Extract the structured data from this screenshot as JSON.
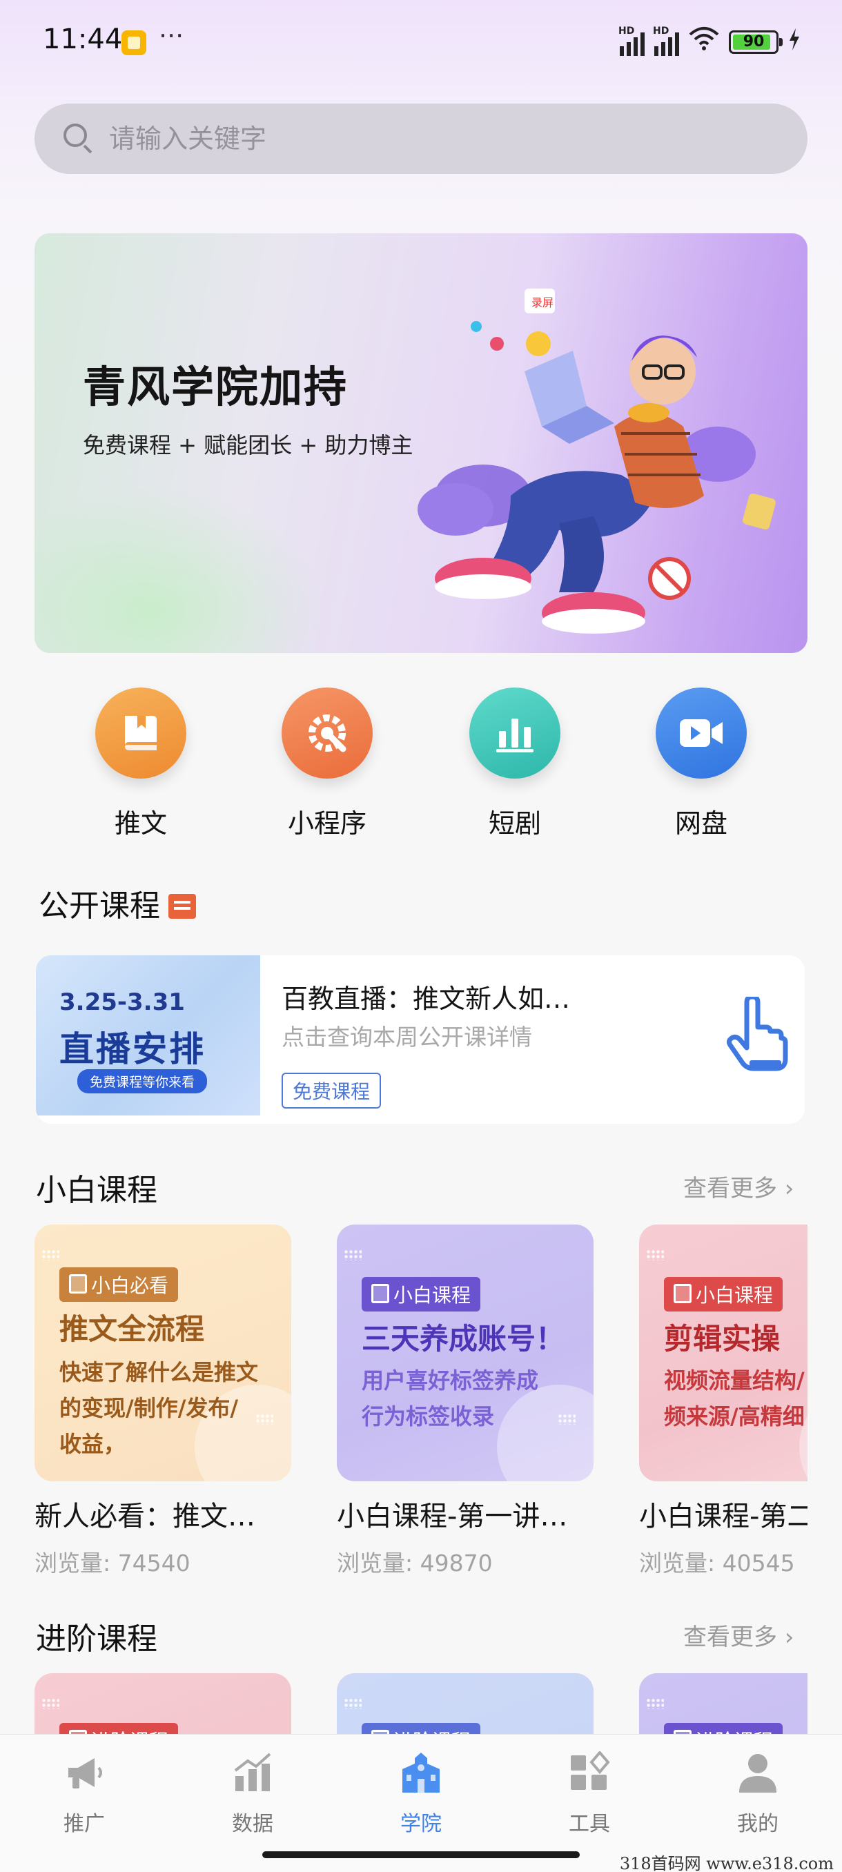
{
  "status_bar": {
    "time": "11:44",
    "battery": "90",
    "more": "···"
  },
  "search": {
    "placeholder": "请输入关键字"
  },
  "banner": {
    "title": "青风学院加持",
    "subtitle": "免费课程 + 赋能团长 + 助力博主"
  },
  "quick_actions": [
    {
      "label": "推文",
      "icon": "book-icon",
      "color": "#f19a3e"
    },
    {
      "label": "小程序",
      "icon": "gear-wrench-icon",
      "color": "#f07f4f"
    },
    {
      "label": "短剧",
      "icon": "bar-chart-icon",
      "color": "#3fc8bb"
    },
    {
      "label": "网盘",
      "icon": "video-camera-icon",
      "color": "#3f86ea"
    }
  ],
  "open_courses": {
    "title": "公开课程",
    "card": {
      "thumb_date": "3.25-3.31",
      "thumb_title": "直播安排",
      "thumb_pill": "免费课程等你来看",
      "title": "百教直播：推文新人如…",
      "subtitle": "点击查询本周公开课详情",
      "badge": "免费课程"
    }
  },
  "beginner_courses": {
    "title": "小白课程",
    "more": "查看更多",
    "items": [
      {
        "tag": "小白必看",
        "headline": "推文全流程",
        "desc": "快速了解什么是推文\n的变现/制作/发布/\n收益，",
        "title": "新人必看：推文…",
        "views": "浏览量: 74540",
        "tag_color": "#c8823b",
        "text_color": "#9a5a1b"
      },
      {
        "tag": "小白课程",
        "headline": "三天养成账号！",
        "desc": "用户喜好标签养成\n行为标签收录",
        "title": "小白课程-第一讲…",
        "views": "浏览量: 49870",
        "tag_color": "#6b52cf",
        "text_color": "#4e34b7"
      },
      {
        "tag": "小白课程",
        "headline": "剪辑实操",
        "desc": "视频流量结构/\n频来源/高精细",
        "title": "小白课程-第二",
        "views": "浏览量: 40545",
        "tag_color": "#dc4a4a",
        "text_color": "#b5282c"
      }
    ]
  },
  "advanced_courses": {
    "title": "进阶课程",
    "more": "查看更多",
    "items": [
      {
        "tag": "进阶课程",
        "tag_color": "#dc4a4a"
      },
      {
        "tag": "进阶课程",
        "tag_color": "#5a6fd8"
      },
      {
        "tag": "进阶课程",
        "tag_color": "#6b52cf"
      }
    ]
  },
  "bottom_nav": [
    {
      "label": "推广",
      "icon": "megaphone-icon",
      "active": false
    },
    {
      "label": "数据",
      "icon": "chart-icon",
      "active": false
    },
    {
      "label": "学院",
      "icon": "school-icon",
      "active": true
    },
    {
      "label": "工具",
      "icon": "tools-icon",
      "active": false
    },
    {
      "label": "我的",
      "icon": "user-icon",
      "active": false
    }
  ],
  "watermark": "318首码网  www.e318.com"
}
